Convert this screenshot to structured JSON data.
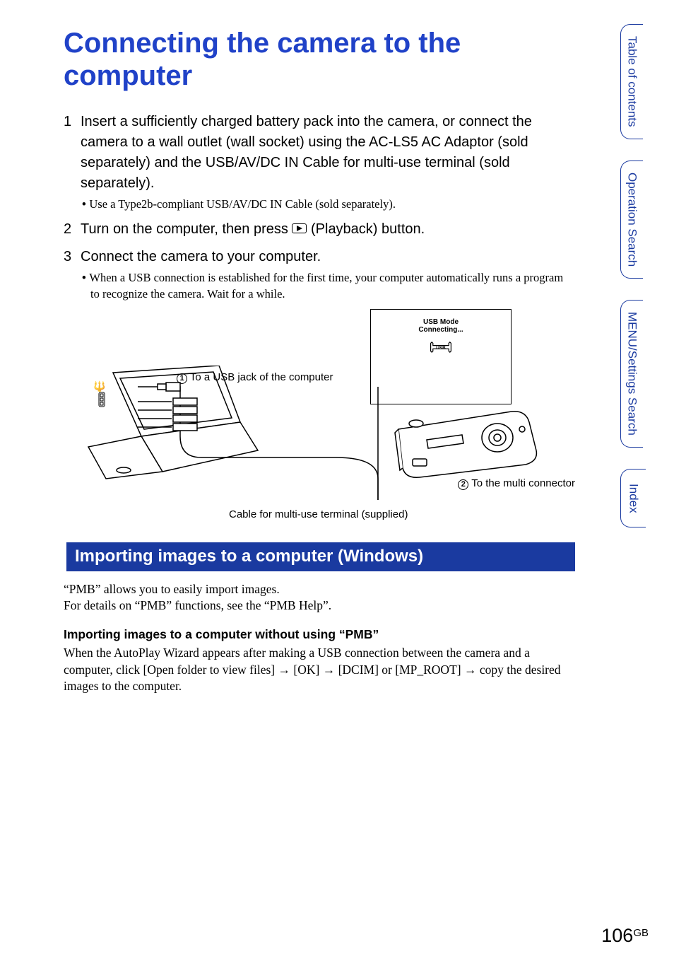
{
  "title": "Connecting the camera to the computer",
  "steps": {
    "s1": {
      "num": "1",
      "text": "Insert a sufficiently charged battery pack into the camera, or connect the camera to a wall outlet (wall socket) using the AC-LS5 AC Adaptor (sold separately) and the USB/AV/DC IN Cable for multi-use terminal (sold separately).",
      "bullet": "Use a Type2b-compliant USB/AV/DC IN Cable (sold separately)."
    },
    "s2": {
      "num": "2",
      "text_before": "Turn on the computer, then press ",
      "text_after": " (Playback) button."
    },
    "s3": {
      "num": "3",
      "text": "Connect the camera to your computer.",
      "bullet": "When a USB connection is established for the first time, your computer automatically runs a program to recognize the camera. Wait for a while."
    }
  },
  "diagram": {
    "screen_line1": "USB Mode",
    "screen_line2": "Connecting...",
    "label_usb_jack": "To a USB jack of the computer",
    "label_multi_connector": "To the multi connector",
    "label_cable": "Cable for multi-use terminal (supplied)",
    "usb_badge_text": "USB"
  },
  "section": {
    "heading": "Importing images to a computer (Windows)",
    "p1": "“PMB” allows you to easily import images.",
    "p2": "For details on “PMB” functions, see the “PMB Help”.",
    "subhead": "Importing images to a computer without using “PMB”",
    "p3_a": "When the AutoPlay Wizard appears after making a USB connection between the camera and a computer, click [Open folder to view files] ",
    "p3_b": " [OK] ",
    "p3_c": " [DCIM] or [MP_ROOT] ",
    "p3_d": " copy the desired images to the computer."
  },
  "tabs": {
    "toc": "Table of contents",
    "op": "Operation Search",
    "menu": "MENU/Settings Search",
    "index": "Index"
  },
  "page": {
    "num": "106",
    "suffix": "GB"
  }
}
